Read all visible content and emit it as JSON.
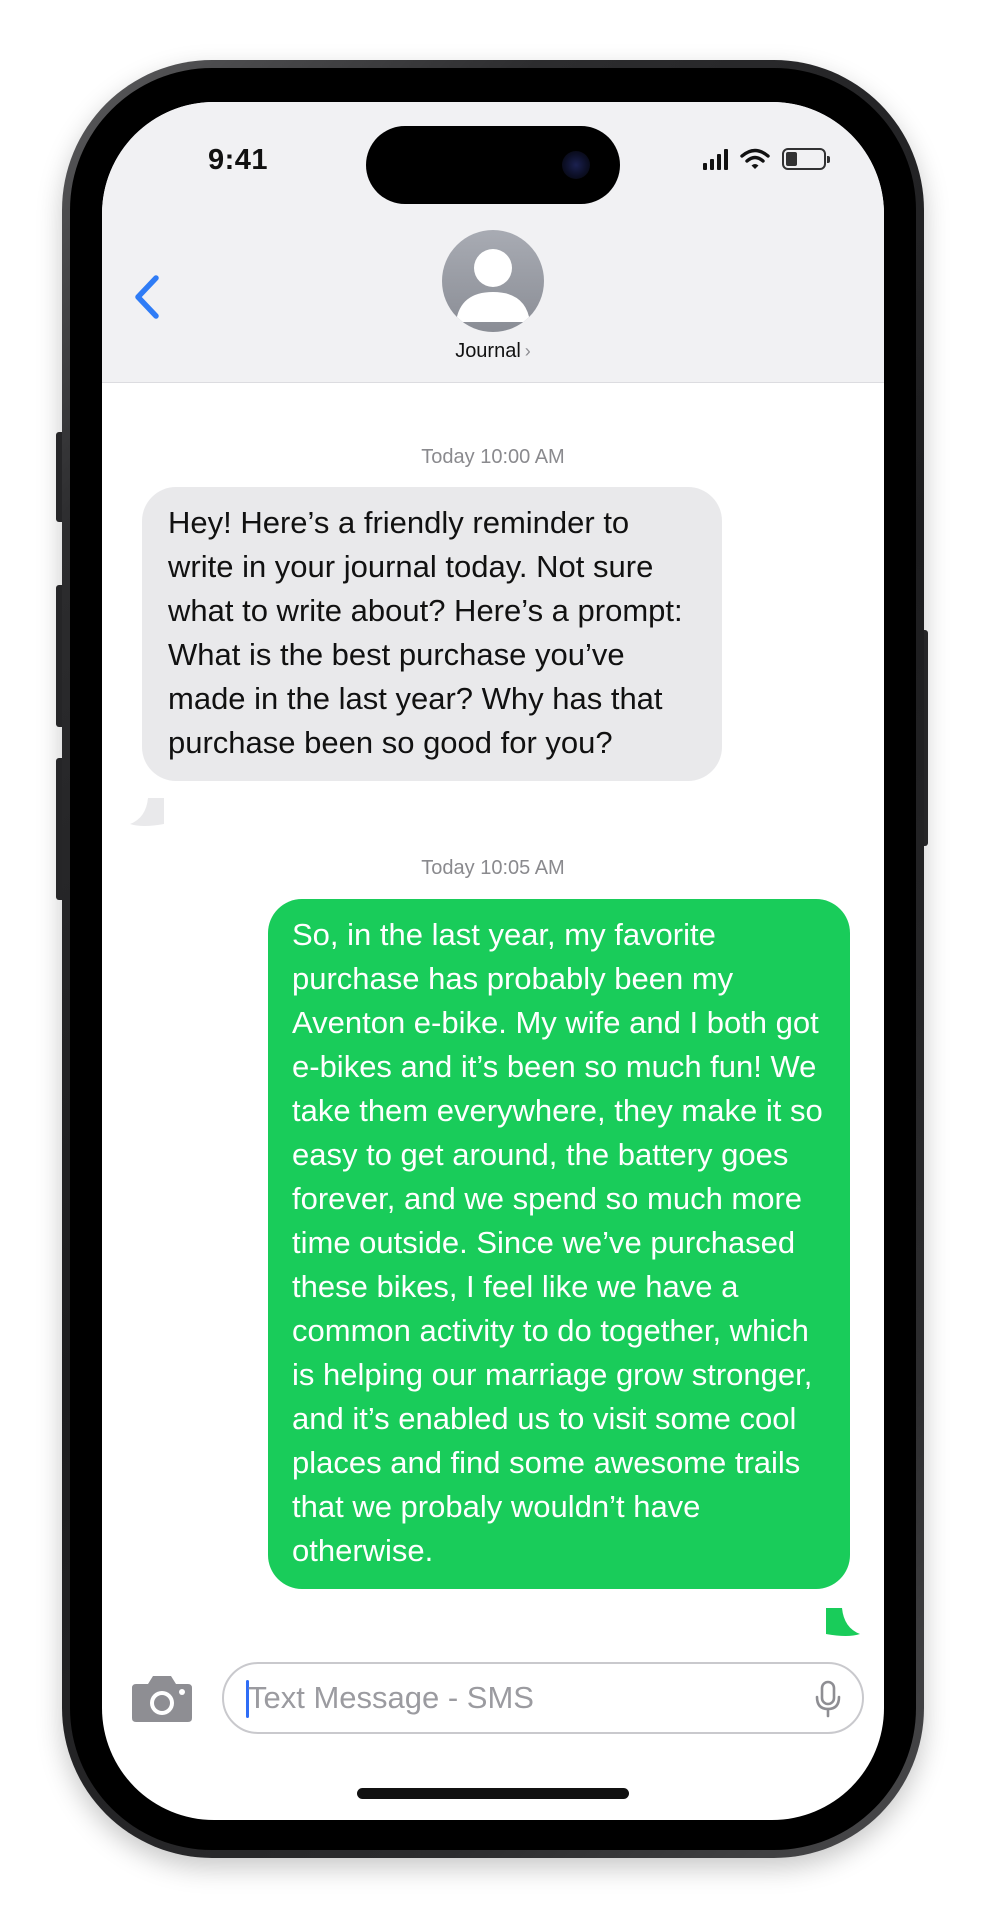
{
  "status_bar": {
    "time": "9:41",
    "icons": [
      "cellular-signal-icon",
      "wifi-icon",
      "battery-icon"
    ],
    "battery_level": 0.3
  },
  "header": {
    "back_icon": "chevron-left-icon",
    "avatar_icon": "person-silhouette-icon",
    "contact_name": "Journal",
    "contact_chevron": "›"
  },
  "messages": [
    {
      "timestamp": "Today 10:00 AM",
      "direction": "incoming",
      "text": "Hey! Here’s a friendly reminder to write in your journal today. Not sure what to write about? Here’s a prompt: What is the best purchase you’ve made in the last year? Why has that purchase been so good for you?"
    },
    {
      "timestamp": "Today 10:05 AM",
      "direction": "outgoing",
      "text": "So, in the last year, my favorite purchase has probably been my Aventon e-bike. My wife and I both got e-bikes and it’s been so much fun! We take them everywhere, they make it so easy to get around, the battery goes forever, and we spend so much more time outside. Since we’ve purchased these bikes, I feel like we have a common activity to do together, which is helping our marriage grow stronger, and it’s enabled us to visit some cool places and find some awesome trails that we probaly wouldn’t have otherwise."
    }
  ],
  "composer": {
    "camera_icon": "camera-icon",
    "placeholder": "Text Message - SMS",
    "value": "",
    "mic_icon": "microphone-icon"
  },
  "colors": {
    "outgoing_bubble": "#19cc5a",
    "incoming_bubble": "#e9e9eb",
    "accent": "#2f7cf6",
    "header_background": "#f1f1f3"
  }
}
